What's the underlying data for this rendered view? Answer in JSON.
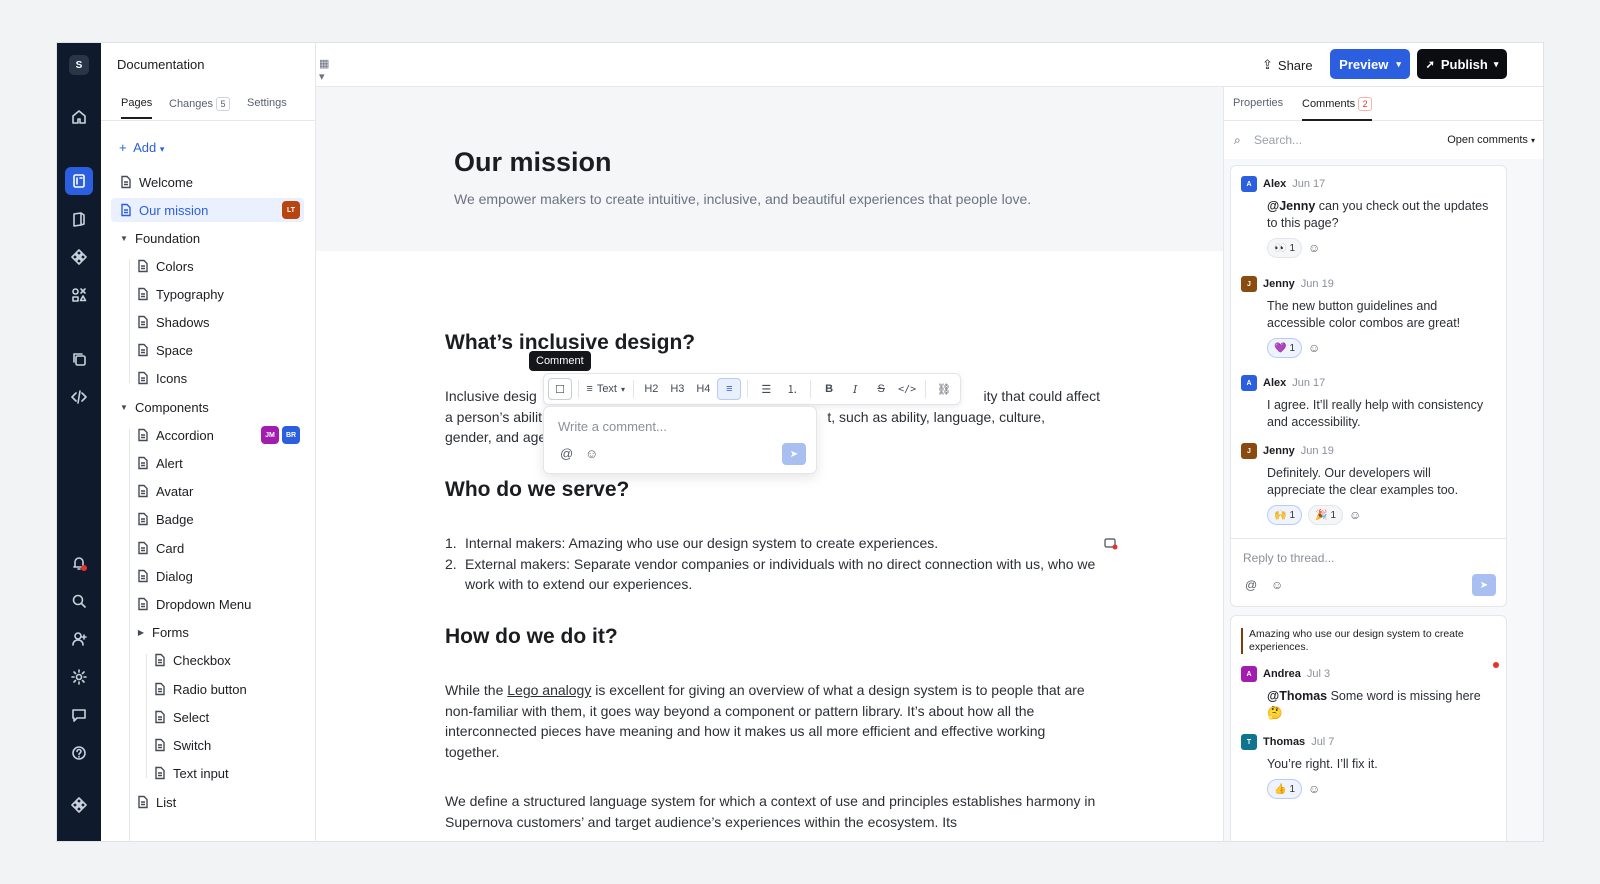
{
  "app": {
    "logo_letter": "S"
  },
  "sidebar": {
    "title": "Documentation",
    "tabs": [
      {
        "label": "Pages"
      },
      {
        "label": "Changes",
        "count": "5"
      },
      {
        "label": "Settings"
      }
    ],
    "add_label": "Add",
    "items": [
      {
        "label": "Welcome"
      },
      {
        "label": "Our mission",
        "badge": "LT"
      },
      {
        "label": "Foundation"
      },
      {
        "label": "Colors"
      },
      {
        "label": "Typography"
      },
      {
        "label": "Shadows"
      },
      {
        "label": "Space"
      },
      {
        "label": "Icons"
      },
      {
        "label": "Components"
      },
      {
        "label": "Accordion",
        "badges": [
          "JM",
          "BR"
        ]
      },
      {
        "label": "Alert"
      },
      {
        "label": "Avatar"
      },
      {
        "label": "Badge"
      },
      {
        "label": "Card"
      },
      {
        "label": "Dialog"
      },
      {
        "label": "Dropdown Menu"
      },
      {
        "label": "Forms"
      },
      {
        "label": "Checkbox"
      },
      {
        "label": "Radio button"
      },
      {
        "label": "Select"
      },
      {
        "label": "Switch"
      },
      {
        "label": "Text input"
      },
      {
        "label": "List"
      }
    ]
  },
  "topbar": {
    "share_label": "Share",
    "preview_label": "Preview",
    "publish_label": "Publish"
  },
  "page": {
    "title": "Our mission",
    "subtitle": "We empower makers to create intuitive, inclusive, and beautiful experiences that people love.",
    "sections": [
      {
        "heading": "What’s inclusive design?"
      },
      {
        "heading": "Who do we serve?"
      },
      {
        "heading": "How do we do it?"
      }
    ],
    "para1_line1_start": "Inclusive desig",
    "para1_line1_end": "ity that could affect",
    "para1_line2_start": "a person’s abilit",
    "para1_line2_end": "t, such as ability, language, culture,",
    "para1_line3_start": "gender, and age",
    "list": [
      {
        "num": "1.",
        "text": "Internal makers: Amazing who use our design system to create experiences."
      },
      {
        "num": "2.",
        "text": "External makers: Separate vendor companies or individuals with no direct connection with us, who we work with to extend our experiences."
      }
    ],
    "para2_a": "While the ",
    "para2_link": "Lego analogy",
    "para2_b": " is excellent for giving an overview of what a design system is to people that are non-familiar with them, it goes way beyond a component or pattern library. It’s about how all the interconnected pieces have meaning and how it makes us all more efficient and effective working together.",
    "para3": "We define a structured language system for which a context of use and principles establishes harmony in Supernova customers’ and target audience’s experiences within the ecosystem. Its"
  },
  "editor": {
    "tooltip": "Comment",
    "text_style_label": "Text",
    "toolbar_buttons": [
      "H2",
      "H3",
      "H4"
    ],
    "comment_placeholder": "Write a comment..."
  },
  "comments_panel": {
    "tabs": [
      {
        "label": "Properties"
      },
      {
        "label": "Comments",
        "count": "2"
      }
    ],
    "search_placeholder": "Search...",
    "filter_label": "Open comments",
    "thread1": [
      {
        "initial": "A",
        "name": "Alex",
        "date": "Jun 17",
        "mention": "@Jenny",
        "text": " can you check out the updates to this page?",
        "reactions": [
          {
            "emoji": "👀",
            "count": "1"
          }
        ]
      },
      {
        "initial": "J",
        "name": "Jenny",
        "date": "Jun 19",
        "text": "The new button guidelines and accessible color combos are great!",
        "reactions": [
          {
            "emoji": "💜",
            "count": "1"
          }
        ]
      },
      {
        "initial": "A",
        "name": "Alex",
        "date": "Jun 17",
        "text": "I agree. It’ll really help with consistency and accessibility."
      },
      {
        "initial": "J",
        "name": "Jenny",
        "date": "Jun 19",
        "text": "Definitely. Our developers will appreciate the clear examples too.",
        "reactions": [
          {
            "emoji": "🙌",
            "count": "1"
          },
          {
            "emoji": "🎉",
            "count": "1"
          }
        ]
      }
    ],
    "reply_placeholder": "Reply to thread...",
    "thread2": {
      "quote": "Amazing who use our design system to create experiences.",
      "comments": [
        {
          "initial": "A",
          "name": "Andrea",
          "date": "Jul 3",
          "mention": "@Thomas",
          "text": " Some word is missing here 🤔"
        },
        {
          "initial": "T",
          "name": "Thomas",
          "date": "Jul 7",
          "text": "You’re right. I’ll fix it.",
          "reactions": [
            {
              "emoji": "👍",
              "count": "1"
            }
          ]
        }
      ]
    }
  },
  "colors": {
    "accent": "#2b5fe0",
    "rail_bg": "#0f1b2d",
    "avatar_alex": "#2b5fe0",
    "avatar_jenny": "#8a4b10",
    "avatar_andrea": "#a21caf",
    "avatar_thomas": "#0e7490"
  }
}
